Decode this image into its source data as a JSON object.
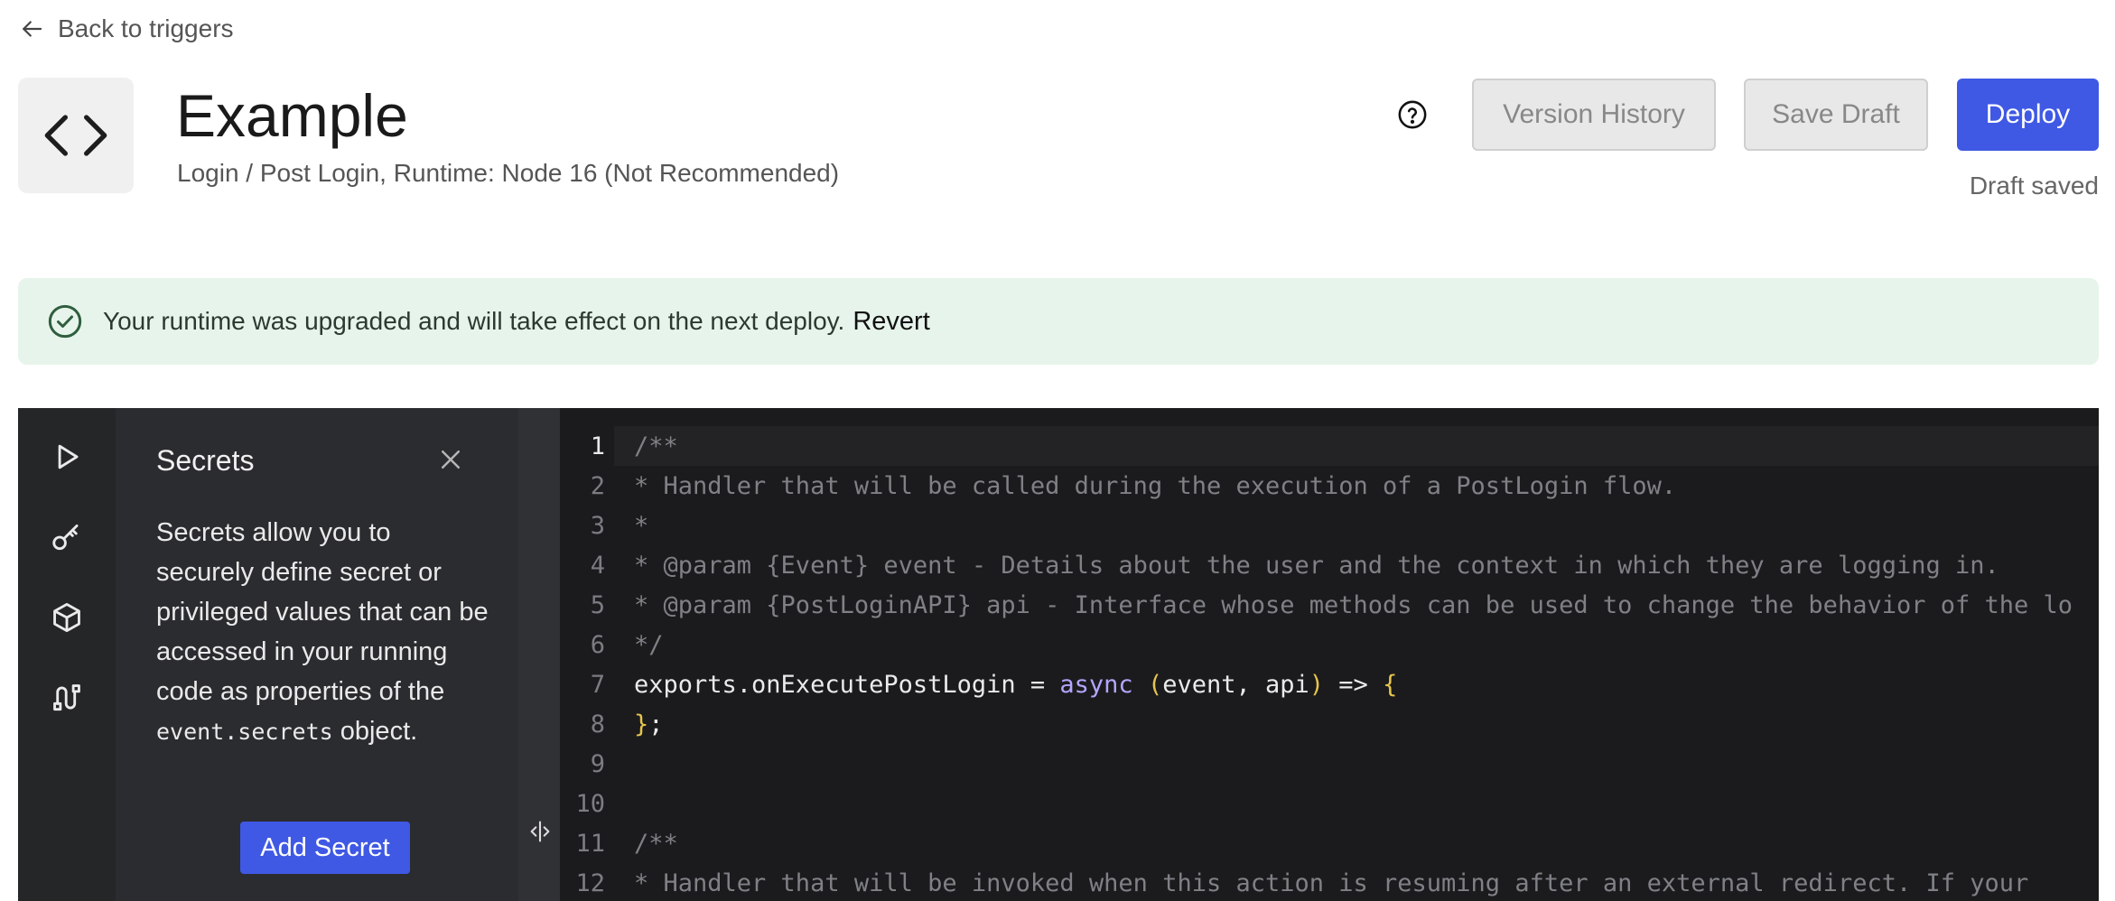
{
  "nav": {
    "back_label": "Back to triggers"
  },
  "header": {
    "title": "Example",
    "subtitle": "Login / Post Login, Runtime: Node 16 (Not Recommended)",
    "version_history_label": "Version History",
    "save_draft_label": "Save Draft",
    "deploy_label": "Deploy",
    "draft_status": "Draft saved"
  },
  "notice": {
    "message": "Your runtime was upgraded and will take effect on the next deploy.",
    "action_label": "Revert"
  },
  "sidebar": {
    "items": [
      {
        "icon": "play-icon"
      },
      {
        "icon": "key-icon"
      },
      {
        "icon": "package-icon"
      },
      {
        "icon": "version-control-icon"
      }
    ]
  },
  "secrets_panel": {
    "title": "Secrets",
    "description": "Secrets allow you to securely define secret or privileged values that can be accessed in your running code as properties of the",
    "code_term": "event.secrets",
    "description_suffix": "object.",
    "add_button_label": "Add Secret"
  },
  "editor": {
    "lines": [
      {
        "n": "1",
        "text": "/**"
      },
      {
        "n": "2",
        "text": "* Handler that will be called during the execution of a PostLogin flow."
      },
      {
        "n": "3",
        "text": "*"
      },
      {
        "n": "4",
        "text": "* @param {Event} event - Details about the user and the context in which they are logging in."
      },
      {
        "n": "5",
        "text": "* @param {PostLoginAPI} api - Interface whose methods can be used to change the behavior of the lo"
      },
      {
        "n": "6",
        "text": "*/"
      },
      {
        "n": "7",
        "prefix": "exports.onExecutePostLogin = ",
        "keyword": "async",
        "open_paren": "(",
        "args": "event, api",
        "close_paren": ")",
        "arrow": " => ",
        "brace": "{"
      },
      {
        "n": "8",
        "brace": "}",
        "rest": ";"
      },
      {
        "n": "9",
        "text": ""
      },
      {
        "n": "10",
        "text": ""
      },
      {
        "n": "11",
        "text": "/**"
      },
      {
        "n": "12",
        "text": "* Handler that will be invoked when this action is resuming after an external redirect. If your"
      }
    ]
  },
  "colors": {
    "accent": "#3f59e4",
    "notice_bg": "#e7f4eb",
    "editor_bg": "#1b1b1d",
    "keyword": "#b2a6ff",
    "paren": "#e6c54d"
  }
}
